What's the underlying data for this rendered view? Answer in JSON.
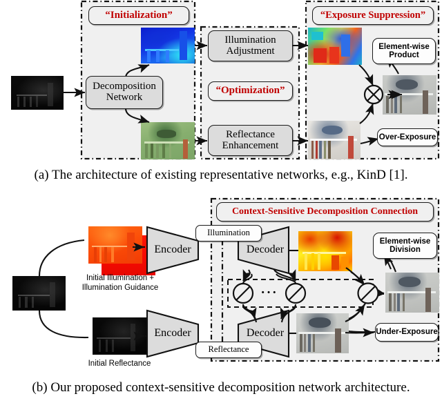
{
  "figure": {
    "panel_a": {
      "caption": "(a) The architecture of existing representative networks, e.g., KinD [1].",
      "groups": [
        {
          "name": "initialization",
          "label": "“Initialization”"
        },
        {
          "name": "optimization",
          "label": "“Optimization”"
        },
        {
          "name": "exposure-suppression",
          "label": "“Exposure Suppression”"
        }
      ],
      "blocks": [
        {
          "name": "decomposition-network",
          "label": "Decomposition\nNetwork"
        },
        {
          "name": "illumination-adjustment",
          "label": "Illumination\nAdjustment"
        },
        {
          "name": "reflectance-enhancement",
          "label": "Reflectance\nEnhancement"
        },
        {
          "name": "element-wise-product",
          "label": "Element-wise\nProduct"
        },
        {
          "name": "over-exposure",
          "label": "Over-Exposure"
        }
      ],
      "operator": "⊗",
      "images": [
        {
          "name": "input-low-light-image",
          "kind": "dark"
        },
        {
          "name": "initial-illumination-map",
          "kind": "blue-illum"
        },
        {
          "name": "initial-reflectance-map",
          "kind": "green-refl"
        },
        {
          "name": "adjusted-illumination-map",
          "kind": "jet-illum"
        },
        {
          "name": "enhanced-reflectance-map",
          "kind": "bright-refl"
        },
        {
          "name": "final-result-image",
          "kind": "result"
        }
      ]
    },
    "panel_b": {
      "caption": "(b) Our proposed context-sensitive decomposition network architecture.",
      "group": {
        "name": "csdc",
        "label": "Context-Sensitive Decomposition Connection"
      },
      "blocks": [
        {
          "name": "encoder-illumination",
          "label": "Encoder"
        },
        {
          "name": "decoder-illumination",
          "label": "Decoder"
        },
        {
          "name": "encoder-reflectance",
          "label": "Encoder"
        },
        {
          "name": "decoder-reflectance",
          "label": "Decoder"
        },
        {
          "name": "illumination-branch-tag",
          "label": "Illumination"
        },
        {
          "name": "reflectance-branch-tag",
          "label": "Reflectance"
        },
        {
          "name": "element-wise-division",
          "label": "Element-wise\nDivision"
        },
        {
          "name": "under-exposure",
          "label": "Under-Exposure"
        }
      ],
      "image_captions": [
        {
          "name": "initial-illumination-caption",
          "label": "Initial Illumination +\nIllumination Guidance"
        },
        {
          "name": "initial-reflectance-caption",
          "label": "Initial Reflectance"
        }
      ],
      "operator": "⊘",
      "ellipsis": "···",
      "images": [
        {
          "name": "input-low-light-image",
          "kind": "dark"
        },
        {
          "name": "initial-illumination-guidance-back",
          "kind": "red-flat"
        },
        {
          "name": "initial-illumination-front",
          "kind": "orange-illum"
        },
        {
          "name": "initial-reflectance-image",
          "kind": "dark"
        },
        {
          "name": "decoded-illumination-map",
          "kind": "hot-illum"
        },
        {
          "name": "decoded-reflectance-map",
          "kind": "grey-refl"
        },
        {
          "name": "final-result-image",
          "kind": "result"
        }
      ]
    }
  },
  "colors": {
    "accent_red": "#c00000",
    "panel_fill": "#f0f0f0",
    "block_fill": "#dcdcdc",
    "label_fill": "#fdfdfd",
    "stroke": "#1a1a1a"
  }
}
